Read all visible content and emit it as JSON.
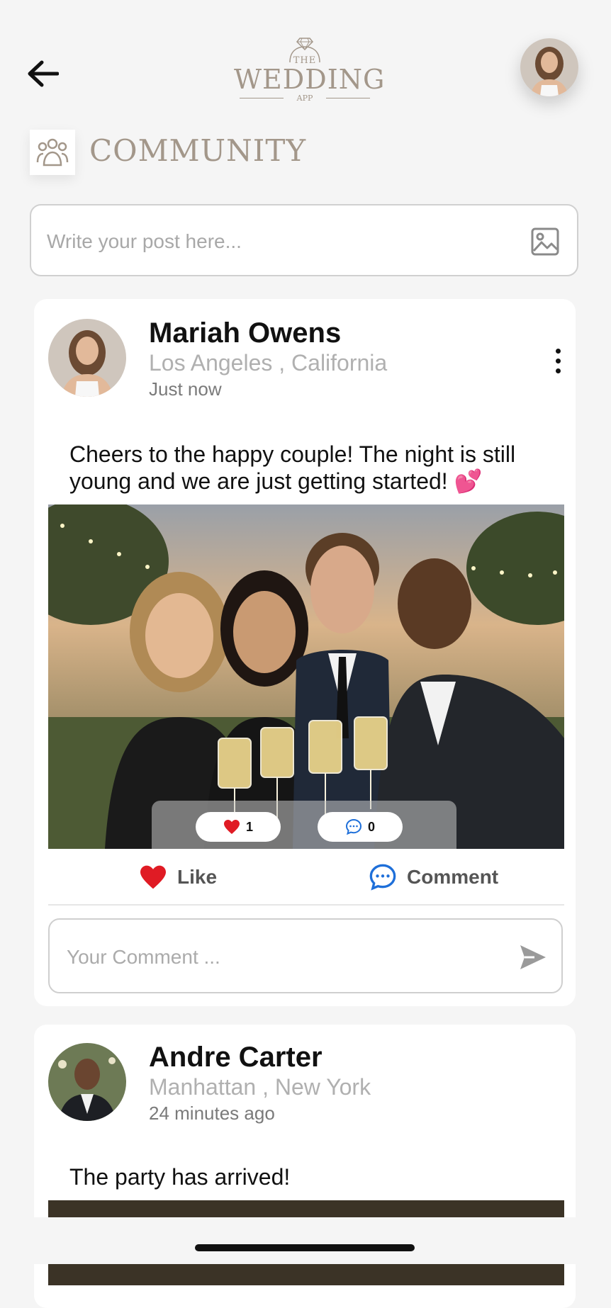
{
  "header": {
    "logo": {
      "line1": "THE",
      "line2": "WEDDING",
      "line3": "APP"
    },
    "section_title": "COMMUNITY"
  },
  "composer": {
    "placeholder": "Write your post here..."
  },
  "posts": [
    {
      "author": "Mariah Owens",
      "location": "Los Angeles , California",
      "time": "Just now",
      "text": "Cheers to the happy couple! The night is still young and we are just getting started! 💕",
      "likes": "1",
      "comments": "0",
      "like_label": "Like",
      "comment_label": "Comment",
      "comment_placeholder": "Your Comment ..."
    },
    {
      "author": "Andre Carter",
      "location": "Manhattan , New York",
      "time": "24 minutes ago",
      "text": "The party has arrived!"
    }
  ],
  "colors": {
    "accent_beige": "#a3978a",
    "like_red": "#e01b24",
    "comment_blue": "#1e6fd9",
    "background": "#f5f5f5"
  }
}
